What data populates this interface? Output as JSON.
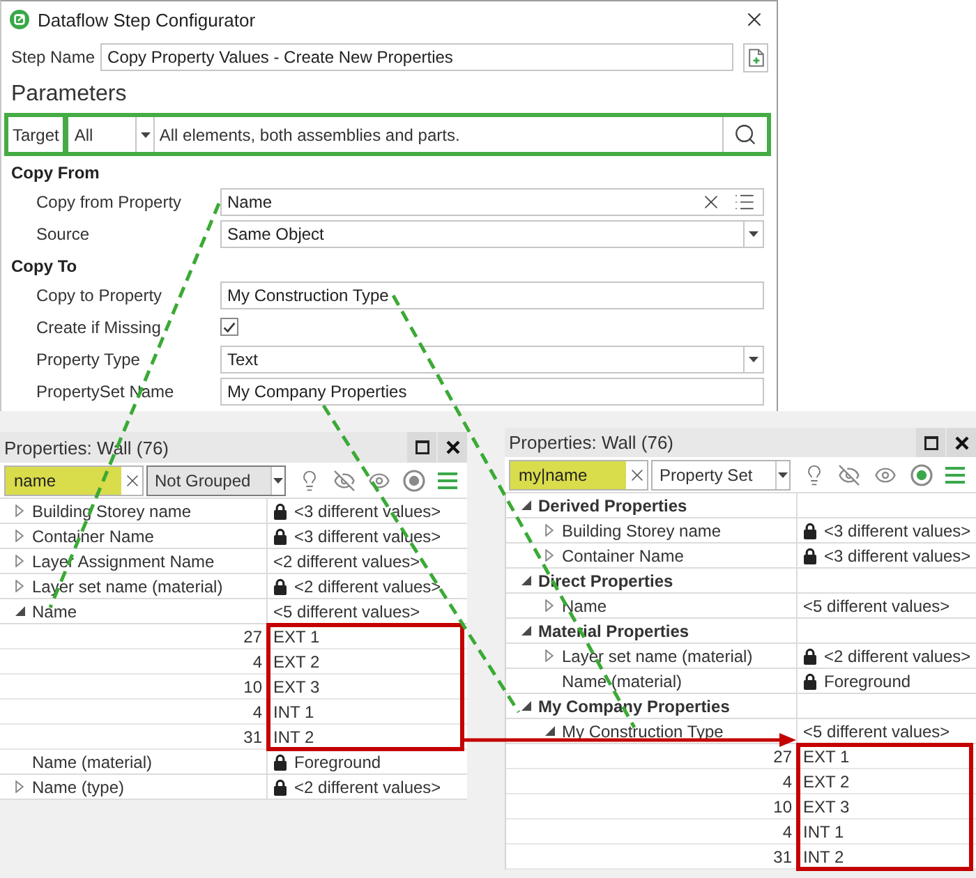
{
  "dialog": {
    "title": "Dataflow Step Configurator",
    "step_name": {
      "label": "Step Name",
      "value": "Copy Property Values - Create New Properties"
    },
    "section_title": "Parameters",
    "target": {
      "label": "Target",
      "value": "All",
      "description": "All elements, both assemblies and parts."
    },
    "groups": [
      {
        "title": "Copy From",
        "fields": [
          {
            "kind": "picker",
            "label": "Copy from Property",
            "value": "Name"
          },
          {
            "kind": "dropdown",
            "label": "Source",
            "value": "Same Object"
          }
        ]
      },
      {
        "title": "Copy To",
        "fields": [
          {
            "kind": "text",
            "label": "Copy to Property",
            "value": "My Construction Type"
          },
          {
            "kind": "checkbox",
            "label": "Create if Missing",
            "checked": true
          },
          {
            "kind": "dropdown",
            "label": "Property Type",
            "value": "Text"
          },
          {
            "kind": "text",
            "label": "PropertySet Name",
            "value": "My Company Properties"
          }
        ]
      }
    ]
  },
  "panels": [
    {
      "title": "Properties: Wall (76)",
      "search": {
        "value": "name"
      },
      "grouping": {
        "value": "Not Grouped",
        "hovered": true
      },
      "toggle": {
        "on": false
      },
      "rows": [
        {
          "kind": "property",
          "name": "Building Storey name",
          "value": "<3 different values>",
          "locked": true,
          "expanded": false
        },
        {
          "kind": "property",
          "name": "Container Name",
          "value": "<3 different values>",
          "locked": true,
          "expanded": false
        },
        {
          "kind": "property",
          "name": "Layer Assignment Name",
          "value": "<2 different values>",
          "locked": false,
          "expanded": false
        },
        {
          "kind": "property",
          "name": "Layer set name (material)",
          "value": "<2 different values>",
          "locked": true,
          "expanded": false
        },
        {
          "kind": "property",
          "name": "Name",
          "value": "<5 different values>",
          "locked": false,
          "expanded": true,
          "highlighted": true,
          "children": [
            {
              "kind": "value",
              "count": "27",
              "value": "EXT 1"
            },
            {
              "kind": "value",
              "count": "4",
              "value": "EXT 2"
            },
            {
              "kind": "value",
              "count": "10",
              "value": "EXT 3"
            },
            {
              "kind": "value",
              "count": "4",
              "value": "INT 1"
            },
            {
              "kind": "value",
              "count": "31",
              "value": "INT 2"
            }
          ]
        },
        {
          "kind": "leaf",
          "name": "Name (material)",
          "value": "Foreground",
          "locked": true
        },
        {
          "kind": "property",
          "name": "Name (type)",
          "value": "<2 different values>",
          "locked": true,
          "expanded": false
        }
      ]
    },
    {
      "title": "Properties: Wall (76)",
      "search": {
        "value": "my|name"
      },
      "grouping": {
        "value": "Property Set",
        "hovered": false
      },
      "toggle": {
        "on": true
      },
      "rows": [
        {
          "kind": "group",
          "name": "Derived Properties",
          "expanded": true,
          "children": [
            {
              "kind": "property",
              "name": "Building Storey name",
              "value": "<3 different values>",
              "locked": true,
              "expanded": false
            },
            {
              "kind": "property",
              "name": "Container Name",
              "value": "<3 different values>",
              "locked": true,
              "expanded": false
            }
          ]
        },
        {
          "kind": "group",
          "name": "Direct Properties",
          "expanded": true,
          "children": [
            {
              "kind": "property",
              "name": "Name",
              "value": "<5 different values>",
              "locked": false,
              "expanded": false
            }
          ]
        },
        {
          "kind": "group",
          "name": "Material Properties",
          "expanded": true,
          "children": [
            {
              "kind": "property",
              "name": "Layer set name (material)",
              "value": "<2 different values>",
              "locked": true,
              "expanded": false
            },
            {
              "kind": "leaf",
              "name": "Name (material)",
              "value": "Foreground",
              "locked": true
            }
          ]
        },
        {
          "kind": "group",
          "name": "My Company Properties",
          "expanded": true,
          "children": [
            {
              "kind": "property",
              "name": "My Construction Type",
              "value": "<5 different values>",
              "locked": false,
              "expanded": true,
              "highlighted": true,
              "children": [
                {
                  "kind": "value",
                  "count": "27",
                  "value": "EXT 1"
                },
                {
                  "kind": "value",
                  "count": "4",
                  "value": "EXT 2"
                },
                {
                  "kind": "value",
                  "count": "10",
                  "value": "EXT 3"
                },
                {
                  "kind": "value",
                  "count": "4",
                  "value": "INT 1"
                },
                {
                  "kind": "value",
                  "count": "31",
                  "value": "INT 2"
                }
              ]
            }
          ]
        }
      ]
    }
  ]
}
